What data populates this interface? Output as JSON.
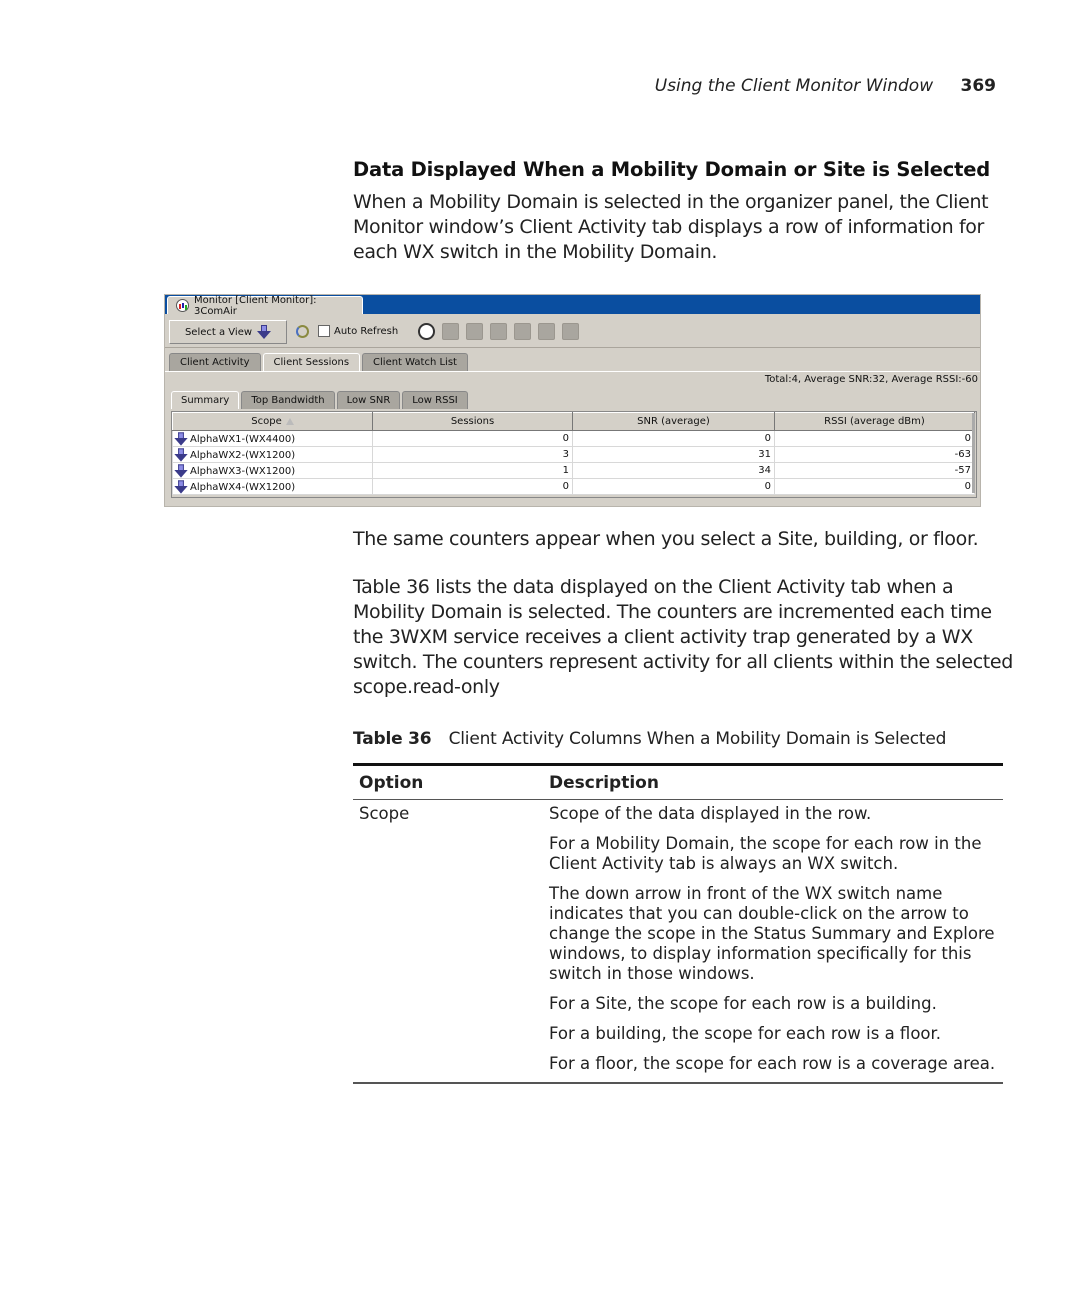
{
  "running_header": {
    "title": "Using the Client Monitor Window",
    "page_number": "369"
  },
  "section_title": "Data Displayed When a Mobility Domain or Site is Selected",
  "paragraphs": {
    "intro": "When a Mobility Domain is selected in the organizer panel, the Client Monitor window’s Client Activity tab displays a row of information for each WX switch in the Mobility Domain.",
    "same_counters": "The same counters appear when you select a Site, building, or floor.",
    "table_ref": "Table 36 lists the data displayed on the Client Activity tab when a Mobility Domain is selected. The counters are incremented each time the 3WXM service receives a client activity trap generated by a WX switch. The counters represent activity for all clients within the selected scope.read-only"
  },
  "screenshot": {
    "window_tab": "Monitor [Client Monitor]: 3ComAir",
    "toolbar": {
      "select_view": "Select a View",
      "auto_refresh_label": "Auto Refresh",
      "auto_refresh_checked": false,
      "icons": [
        "client-search-icon",
        "chart-icon",
        "client-icon",
        "client-watch-icon",
        "clients-group-icon",
        "clients-group-export-icon",
        "report-icon"
      ]
    },
    "tabs": [
      {
        "label": "Client Activity",
        "selected": false
      },
      {
        "label": "Client Sessions",
        "selected": true
      },
      {
        "label": "Client Watch List",
        "selected": false
      }
    ],
    "summary": "Total:4, Average SNR:32, Average RSSI:-60",
    "subtabs": [
      {
        "label": "Summary",
        "selected": true
      },
      {
        "label": "Top Bandwidth",
        "selected": false
      },
      {
        "label": "Low SNR",
        "selected": false
      },
      {
        "label": "Low RSSI",
        "selected": false
      }
    ],
    "columns": [
      "Scope",
      "Sessions",
      "SNR (average)",
      "RSSI (average dBm)"
    ],
    "rows": [
      {
        "scope": "AlphaWX1-(WX4400)",
        "sessions": "0",
        "snr": "0",
        "rssi": "0"
      },
      {
        "scope": "AlphaWX2-(WX1200)",
        "sessions": "3",
        "snr": "31",
        "rssi": "-63"
      },
      {
        "scope": "AlphaWX3-(WX1200)",
        "sessions": "1",
        "snr": "34",
        "rssi": "-57"
      },
      {
        "scope": "AlphaWX4-(WX1200)",
        "sessions": "0",
        "snr": "0",
        "rssi": "0"
      }
    ]
  },
  "table": {
    "label": "Table 36",
    "caption": "Client Activity Columns When a Mobility Domain is Selected",
    "headers": [
      "Option",
      "Description"
    ],
    "rows": [
      {
        "option": "Scope",
        "description": [
          "Scope of the data displayed in the row.",
          "For a Mobility Domain, the scope for each row in the Client Activity tab is always an WX switch.",
          "The down arrow in front of the WX switch name indicates that you can double-click on the arrow to change the scope in the Status Summary and Explore windows, to display information specifically for this switch in those windows.",
          "For a Site, the scope for each row is a building.",
          "For a building, the scope for each row is a floor.",
          "For a floor, the scope for each row is a coverage area."
        ]
      }
    ]
  }
}
